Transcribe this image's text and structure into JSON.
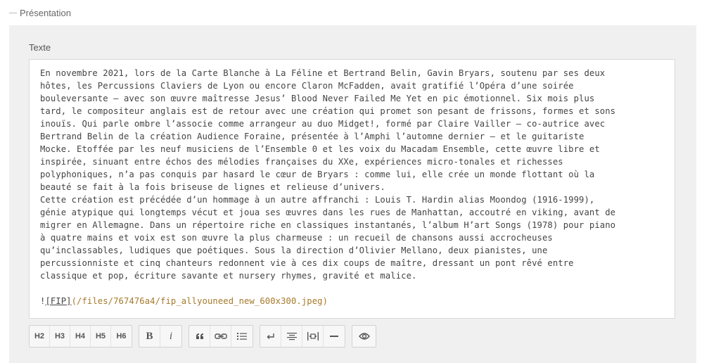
{
  "fieldset": {
    "legend": "Présentation"
  },
  "field": {
    "label": "Texte"
  },
  "editor": {
    "lines": [
      "En novembre 2021, lors de la Carte Blanche à La Féline et Bertrand Belin, Gavin Bryars, soutenu par ses deux",
      "hôtes, les Percussions Claviers de Lyon ou encore Claron McFadden, avait gratifié l’Opéra d’une soirée",
      "bouleversante – avec son œuvre maîtresse Jesus’ Blood Never Failed Me Yet en pic émotionnel. Six mois plus",
      "tard, le compositeur anglais est de retour avec une création qui promet son pesant de frissons, formes et sons",
      "inouïs. Qui parle ombre l’associe comme arrangeur au duo Midget!, formé par Claire Vailler – co-autrice avec",
      "Bertrand Belin de la création Audience Foraine, présentée à l’Amphi l’automne dernier – et le guitariste",
      "Mocke. Etoffée par les neuf musiciens de l’Ensemble 0 et les voix du Macadam Ensemble, cette œuvre libre et",
      "inspirée, sinuant entre échos des mélodies françaises du XXe, expériences micro-tonales et richesses",
      "polyphoniques, n’a pas conquis par hasard le cœur de Bryars : comme lui, elle crée un monde flottant où la",
      "beauté se fait à la fois briseuse de lignes et relieuse d’univers.",
      "Cette création est précédée d’un hommage à un autre affranchi : Louis T. Hardin alias Moondog (1916-1999),",
      "génie atypique qui longtemps vécut et joua ses œuvres dans les rues de Manhattan, accoutré en viking, avant de",
      "migrer en Allemagne. Dans un répertoire riche en classiques instantanés, l’album H’art Songs (1978) pour piano",
      "à quatre mains et voix est son œuvre la plus charmeuse : un recueil de chansons aussi accrocheuses",
      "qu’inclassables, ludiques que poétiques. Sous la direction d’Olivier Mellano, deux pianistes, une",
      "percussionniste et cinq chanteurs redonnent vie à ces dix coups de maître, dressant un pont rêvé entre",
      "classique et pop, écriture savante et nursery rhymes, gravité et malice.",
      ""
    ],
    "image_markdown": {
      "bang": "!",
      "alt": "[FIP]",
      "url": "(/files/767476a4/fip_allyouneed_new_600x300.jpeg)"
    }
  },
  "toolbar": {
    "headings": [
      "H2",
      "H3",
      "H4",
      "H5",
      "H6"
    ],
    "bold": "B",
    "italic": "i",
    "icons": [
      "quote-icon",
      "link-icon",
      "list-icon",
      "line-break-icon",
      "align-center-icon",
      "justify-icon",
      "horizontal-rule-icon",
      "preview-eye-icon"
    ]
  },
  "colors": {
    "panel": "#f0f0f0",
    "url": "#a6792a"
  }
}
